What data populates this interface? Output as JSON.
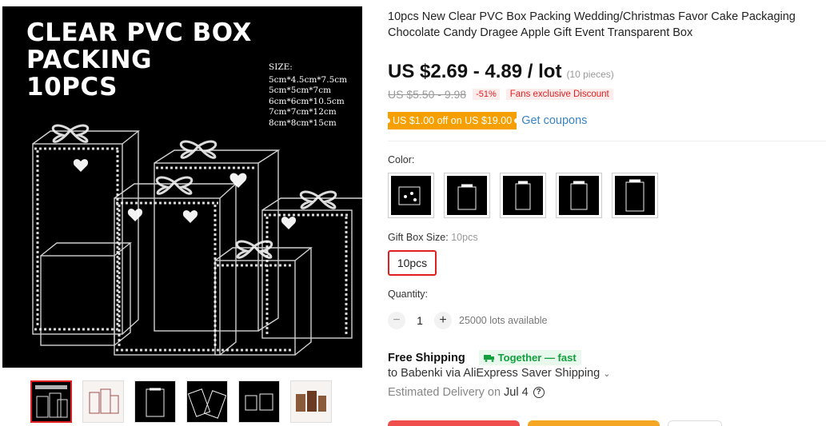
{
  "product": {
    "title": "10pcs New Clear PVC Box Packing Wedding/Christmas Favor Cake Packaging Chocolate Candy Dragee Apple Gift Event Transparent Box",
    "image": {
      "headline_line1": "CLEAR PVC BOX PACKING",
      "headline_line2": "10PCS",
      "size_label": "SIZE:",
      "sizes": [
        "5cm*4.5cm*7.5cm",
        "5cm*5cm*7cm",
        "6cm*6cm*10.5cm",
        "7cm*7cm*12cm",
        "8cm*8cm*15cm"
      ]
    },
    "thumbnails_count": 6
  },
  "pricing": {
    "price": "US $2.69 - 4.89 / lot",
    "price_note": "(10 pieces)",
    "original_price": "US $5.50 - 9.98",
    "discount_pct": "-51%",
    "fans_badge": "Fans exclusive Discount",
    "coupon_badge": "US $1.00 off on US $19.00",
    "get_coupons": "Get coupons"
  },
  "options": {
    "color_label": "Color:",
    "color_swatches_count": 5,
    "size_label": "Gift Box Size:",
    "size_selected": "10pcs",
    "size_option": "10pcs"
  },
  "quantity": {
    "label": "Quantity:",
    "minus": "−",
    "value": "1",
    "plus": "+",
    "available": "25000 lots available"
  },
  "shipping": {
    "title": "Free Shipping",
    "badge": "Together — fast",
    "to_text": "to Babenki via AliExpress Saver Shipping",
    "chevron": "⌄",
    "delivery_label": "Estimated Delivery on",
    "delivery_date": "Jul 4",
    "help": "?"
  },
  "colors": {
    "accent_red": "#e02020",
    "coupon_orange": "#f5a000",
    "link_blue": "#3a84c4",
    "green": "#12a03f"
  }
}
